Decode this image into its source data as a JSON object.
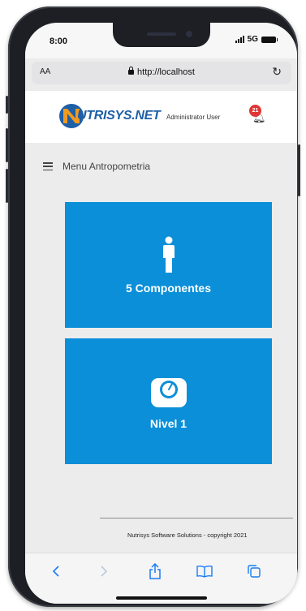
{
  "status_bar": {
    "time": "8:00",
    "network": "5G"
  },
  "browser": {
    "text_size_label": "AA",
    "url": "http://localhost"
  },
  "header": {
    "logo_text": "UTRISYS.NET",
    "user_name": "Administrator User",
    "notification_count": "21"
  },
  "menu": {
    "title": "Menu Antropometria"
  },
  "cards": [
    {
      "label": "5 Componentes",
      "icon": "person-icon"
    },
    {
      "label": "Nivel 1",
      "icon": "scale-icon"
    }
  ],
  "footer": {
    "text": "Nutrisys Software Solutions - copyright 2021"
  },
  "colors": {
    "card": "#0b8fd8",
    "brand_blue": "#1f5fa6",
    "brand_orange": "#f29a1f",
    "badge": "#e03535"
  }
}
